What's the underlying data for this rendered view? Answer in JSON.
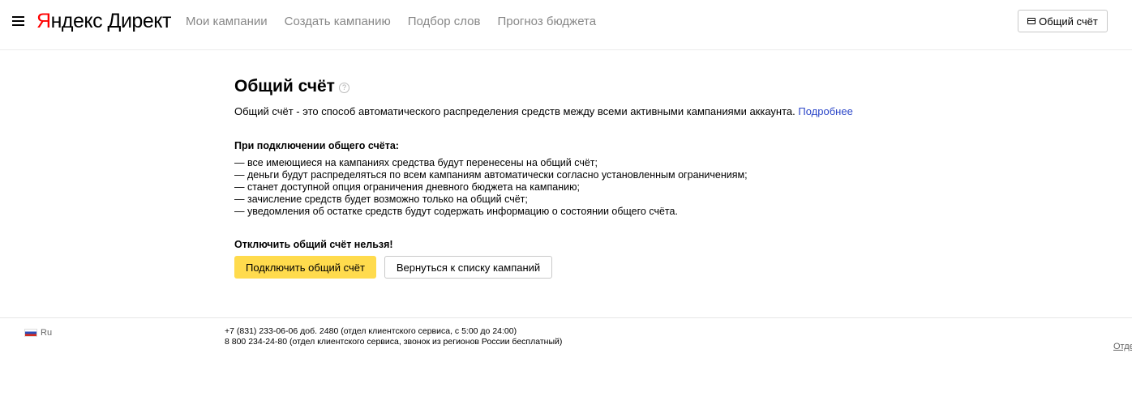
{
  "header": {
    "logo": {
      "brand_first_letter": "Я",
      "brand_rest": "ндекс",
      "product": "Директ"
    },
    "nav": [
      {
        "label": "Мои кампании"
      },
      {
        "label": "Создать кампанию"
      },
      {
        "label": "Подбор слов"
      },
      {
        "label": "Прогноз бюджета"
      }
    ],
    "account_button_label": "Общий счёт",
    "icons": {
      "menu": "burger-menu-icon",
      "account": "wallet-icon"
    }
  },
  "main": {
    "title": "Общий счёт",
    "help_glyph": "?",
    "intro_text": "Общий счёт - это способ автоматического распределения средств между всеми активными кампаниями аккаунта.",
    "intro_link": "Подробнее",
    "conditions_heading": "При подключении общего счёта:",
    "conditions": [
      "— все имеющиеся на кампаниях средства будут перенесены на общий счёт;",
      "— деньги будут распределяться по всем кампаниям автоматически согласно установленным ограничениям;",
      "— станет доступной опция ограничения дневного бюджета на кампанию;",
      "— зачисление средств будет возможно только на общий счёт;",
      "— уведомления об остатке средств будут содержать информацию о состоянии общего счёта."
    ],
    "warning": "Отключить общий счёт нельзя!",
    "primary_button": "Подключить общий счёт",
    "secondary_button": "Вернуться к списку кампаний"
  },
  "footer": {
    "language": "Ru",
    "phone_lines": [
      "+7 (831) 233-06-06 доб. 2480 (отдел клиентского сервиса, с 5:00 до 24:00)",
      "8 800 234-24-80 (отдел клиентского сервиса, звонок из регионов России бесплатный)"
    ],
    "right_link": "Отде"
  },
  "colors": {
    "brand_red": "#ff0000",
    "primary_button_bg": "#ffdb4d",
    "link_blue": "#2b46c8",
    "nav_gray": "#888888"
  }
}
